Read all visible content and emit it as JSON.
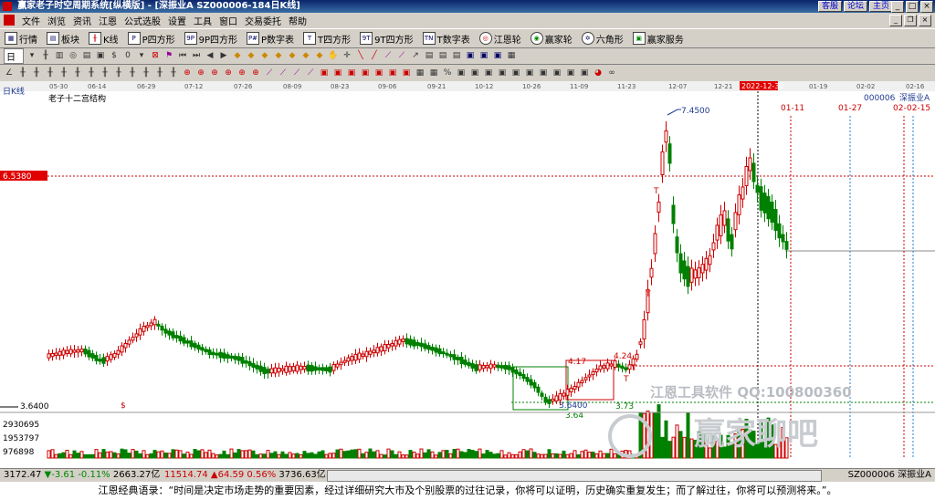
{
  "title": "赢家老子时空周期系统[纵横版] - [深振业A   SZ000006-184日K线]",
  "title_links": [
    "客服",
    "论坛",
    "主页"
  ],
  "menu": [
    "文件",
    "浏览",
    "资讯",
    "江恩",
    "公式选股",
    "设置",
    "工具",
    "窗口",
    "交易委托",
    "帮助"
  ],
  "toolbar_main": [
    {
      "icon": "grid-icon",
      "label": "行情"
    },
    {
      "icon": "blocks-icon",
      "label": "板块"
    },
    {
      "icon": "kline-icon",
      "label": "K线"
    },
    {
      "icon": "p-square-icon",
      "label": "P四方形"
    },
    {
      "icon": "9p-square-icon",
      "label": "9P四方形"
    },
    {
      "icon": "p-table-icon",
      "label": "P数字表"
    },
    {
      "icon": "t-square-icon",
      "label": "T四方形"
    },
    {
      "icon": "9t-square-icon",
      "label": "9T四方形"
    },
    {
      "icon": "t-table-icon",
      "label": "T数字表"
    },
    {
      "icon": "gann-wheel-icon",
      "label": "江恩轮"
    },
    {
      "icon": "winner-wheel-icon",
      "label": "赢家轮"
    },
    {
      "icon": "hexagon-icon",
      "label": "六角形"
    },
    {
      "icon": "service-icon",
      "label": "赢家服务"
    }
  ],
  "period_selector": "日",
  "chart": {
    "panel_label": "日K线",
    "indicator_name": "老子十二宫结构",
    "code": "000006",
    "stock_name": "深振业A",
    "date_labels": [
      "05-30",
      "06-14",
      "06-29",
      "07-12",
      "07-26",
      "08-09",
      "08-23",
      "09-06",
      "09-21",
      "10-12",
      "10-26",
      "11-09",
      "11-23",
      "12-07",
      "12-21",
      "2022-12-30",
      "01-19",
      "02-02",
      "02-16"
    ],
    "future_dates": [
      "01-11",
      "01-27",
      "02-",
      "02-15"
    ],
    "price_left": "6.5380",
    "price_low_left": "3.6400",
    "high_label": "7.4500",
    "low_label": "3.6400",
    "low_label2": "3.64",
    "mid_label_1": "4.17",
    "mid_label_2": "4.24",
    "mid_label_3": "3.73",
    "t_marks": [
      "T",
      "T",
      "T",
      "T"
    ],
    "dollar_mark": "$",
    "volume_labels": [
      "2930695",
      "1953797",
      "976898"
    ],
    "watermark1": "江恩工具软件 QQ:100800360",
    "watermark2": "赢家聊吧",
    "colors": {
      "up": "#cc0000",
      "down": "#008000",
      "highlight": "#ff0000",
      "blue": "#1f3a93"
    }
  },
  "status": {
    "sh": "3172.47",
    "sh_chg": "▼-3.61",
    "sh_pct": "-0.11%",
    "sh_amt": "2663.27亿",
    "sz": "11514.74",
    "sz_chg": "▲64.59",
    "sz_pct": "0.56%",
    "sz_amt": "3736.63亿",
    "right": "SZ000006 深振业A"
  },
  "quote": "江恩经典语录：“时间是决定市场走势的重要因素，经过详细研究大市及个别股票的过往记录，你将可以证明，历史确实重复发生；而了解过往，你将可以预测将来。”。"
}
